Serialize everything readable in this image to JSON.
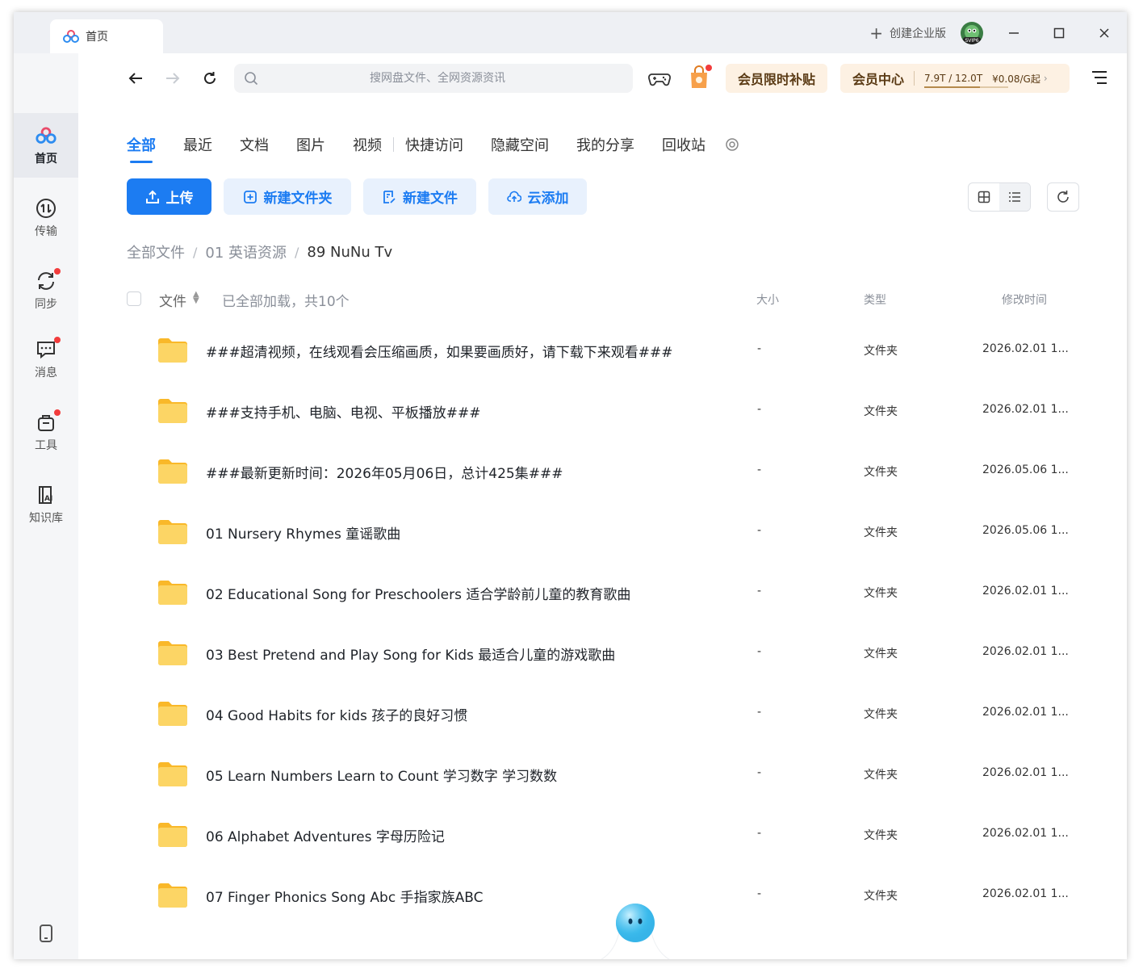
{
  "titlebar": {
    "tab_label": "首页",
    "create_enterprise": "创建企业版",
    "avatar_badge": "SVIP6"
  },
  "sidebar": {
    "items": [
      {
        "label": "首页",
        "icon": "home-logo-icon",
        "active": true
      },
      {
        "label": "传输",
        "icon": "transfer-icon"
      },
      {
        "label": "同步",
        "icon": "sync-icon",
        "dot": true
      },
      {
        "label": "消息",
        "icon": "message-icon",
        "dot": true
      },
      {
        "label": "工具",
        "icon": "tools-icon",
        "dot": true
      },
      {
        "label": "知识库",
        "icon": "knowledge-ai-icon"
      }
    ]
  },
  "toolbar": {
    "search_placeholder": "搜网盘文件、全网资源资讯",
    "vip_subsidy": "会员限时补贴",
    "vip_center": "会员中心",
    "quota": "7.9T / 12.0T",
    "price": "¥0.08/G起",
    "quota_used_fraction": 0.66
  },
  "tabs": [
    "全部",
    "最近",
    "文档",
    "图片",
    "视频",
    "快捷访问",
    "隐藏空间",
    "我的分享",
    "回收站"
  ],
  "actions": {
    "upload": "上传",
    "new_folder": "新建文件夹",
    "new_file": "新建文件",
    "cloud_add": "云添加"
  },
  "breadcrumb": [
    "全部文件",
    "01 英语资源",
    "89 NuNu Tv"
  ],
  "list": {
    "header_file": "文件",
    "loaded_text": "已全部加载，共10个",
    "header_size": "大小",
    "header_type": "类型",
    "header_time": "修改时间",
    "rows": [
      {
        "name": "###超清视频，在线观看会压缩画质，如果要画质好，请下载下来观看###",
        "size": "-",
        "type": "文件夹",
        "time": "2026.02.01 1..."
      },
      {
        "name": "###支持手机、电脑、电视、平板播放###",
        "size": "-",
        "type": "文件夹",
        "time": "2026.02.01 1..."
      },
      {
        "name": "###最新更新时间：2026年05月06日，总计425集###",
        "size": "-",
        "type": "文件夹",
        "time": "2026.05.06 1..."
      },
      {
        "name": "01 Nursery Rhymes 童谣歌曲",
        "size": "-",
        "type": "文件夹",
        "time": "2026.05.06 1..."
      },
      {
        "name": "02 Educational Song for Preschoolers 适合学龄前儿童的教育歌曲",
        "size": "-",
        "type": "文件夹",
        "time": "2026.02.01 1..."
      },
      {
        "name": "03 Best Pretend and Play Song for Kids 最适合儿童的游戏歌曲",
        "size": "-",
        "type": "文件夹",
        "time": "2026.02.01 1..."
      },
      {
        "name": "04 Good Habits for kids 孩子的良好习惯",
        "size": "-",
        "type": "文件夹",
        "time": "2026.02.01 1..."
      },
      {
        "name": "05 Learn Numbers Learn to Count 学习数字 学习数数",
        "size": "-",
        "type": "文件夹",
        "time": "2026.02.01 1..."
      },
      {
        "name": "06 Alphabet Adventures 字母历险记",
        "size": "-",
        "type": "文件夹",
        "time": "2026.02.01 1..."
      },
      {
        "name": "07 Finger Phonics Song Abc 手指家族ABC",
        "size": "-",
        "type": "文件夹",
        "time": "2026.02.01 1..."
      }
    ]
  },
  "colors": {
    "accent": "#1c7cf2",
    "accent_light": "#e8f1fd",
    "vip_bg": "#fdf1e3",
    "vip_text": "#5a3a14",
    "folder": "#fcc94a",
    "red_dot": "#f23c3c"
  }
}
